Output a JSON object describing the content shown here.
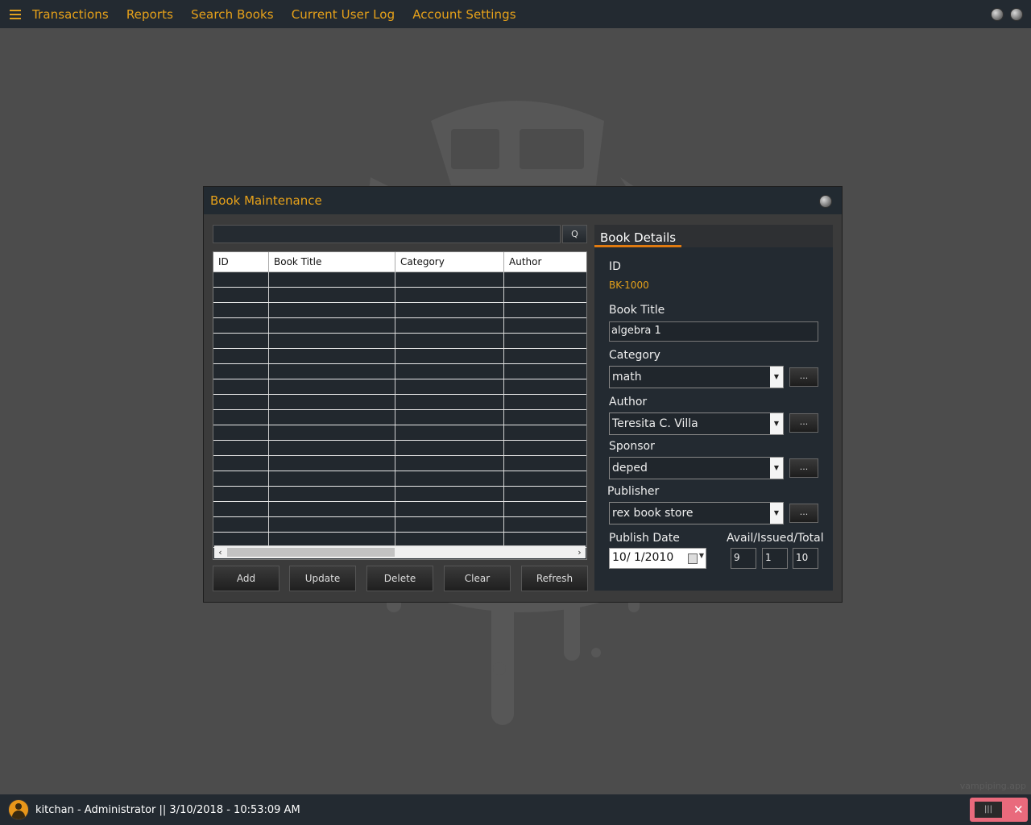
{
  "menu": {
    "items": [
      "Transactions",
      "Reports",
      "Search Books",
      "Current User Log",
      "Account Settings"
    ]
  },
  "dialog": {
    "title": "Book Maintenance",
    "search_button": "Q",
    "grid": {
      "columns": [
        "ID",
        "Book Title",
        "Category",
        "Author"
      ],
      "rows": []
    },
    "buttons": [
      "Add",
      "Update",
      "Delete",
      "Clear",
      "Refresh"
    ]
  },
  "details": {
    "tab": "Book Details",
    "id_label": "ID",
    "id_value": "BK-1000",
    "title_label": "Book Title",
    "title_value": "algebra 1",
    "category_label": "Category",
    "category_value": "math",
    "author_label": "Author",
    "author_value": "Teresita C. Villa",
    "sponsor_label": "Sponsor",
    "sponsor_value": "deped",
    "publisher_label": "Publisher",
    "publisher_value": "rex book store",
    "publish_date_label": "Publish Date",
    "publish_date_value": "10/  1/2010",
    "counts_label": "Avail/Issued/Total",
    "avail": "9",
    "issued": "1",
    "total": "10",
    "ellipsis": "..."
  },
  "status": {
    "text": "kitchan - Administrator || 3/10/2018 - 10:53:09 AM"
  },
  "watermark": "vampiping.app",
  "colors": {
    "accent": "#e6a11a",
    "background": "#4c4c4c",
    "bar": "#232a31"
  },
  "icons": [
    "hamburger-icon",
    "window-dot-icon",
    "user-avatar-icon",
    "calendar-icon",
    "close-icon"
  ]
}
